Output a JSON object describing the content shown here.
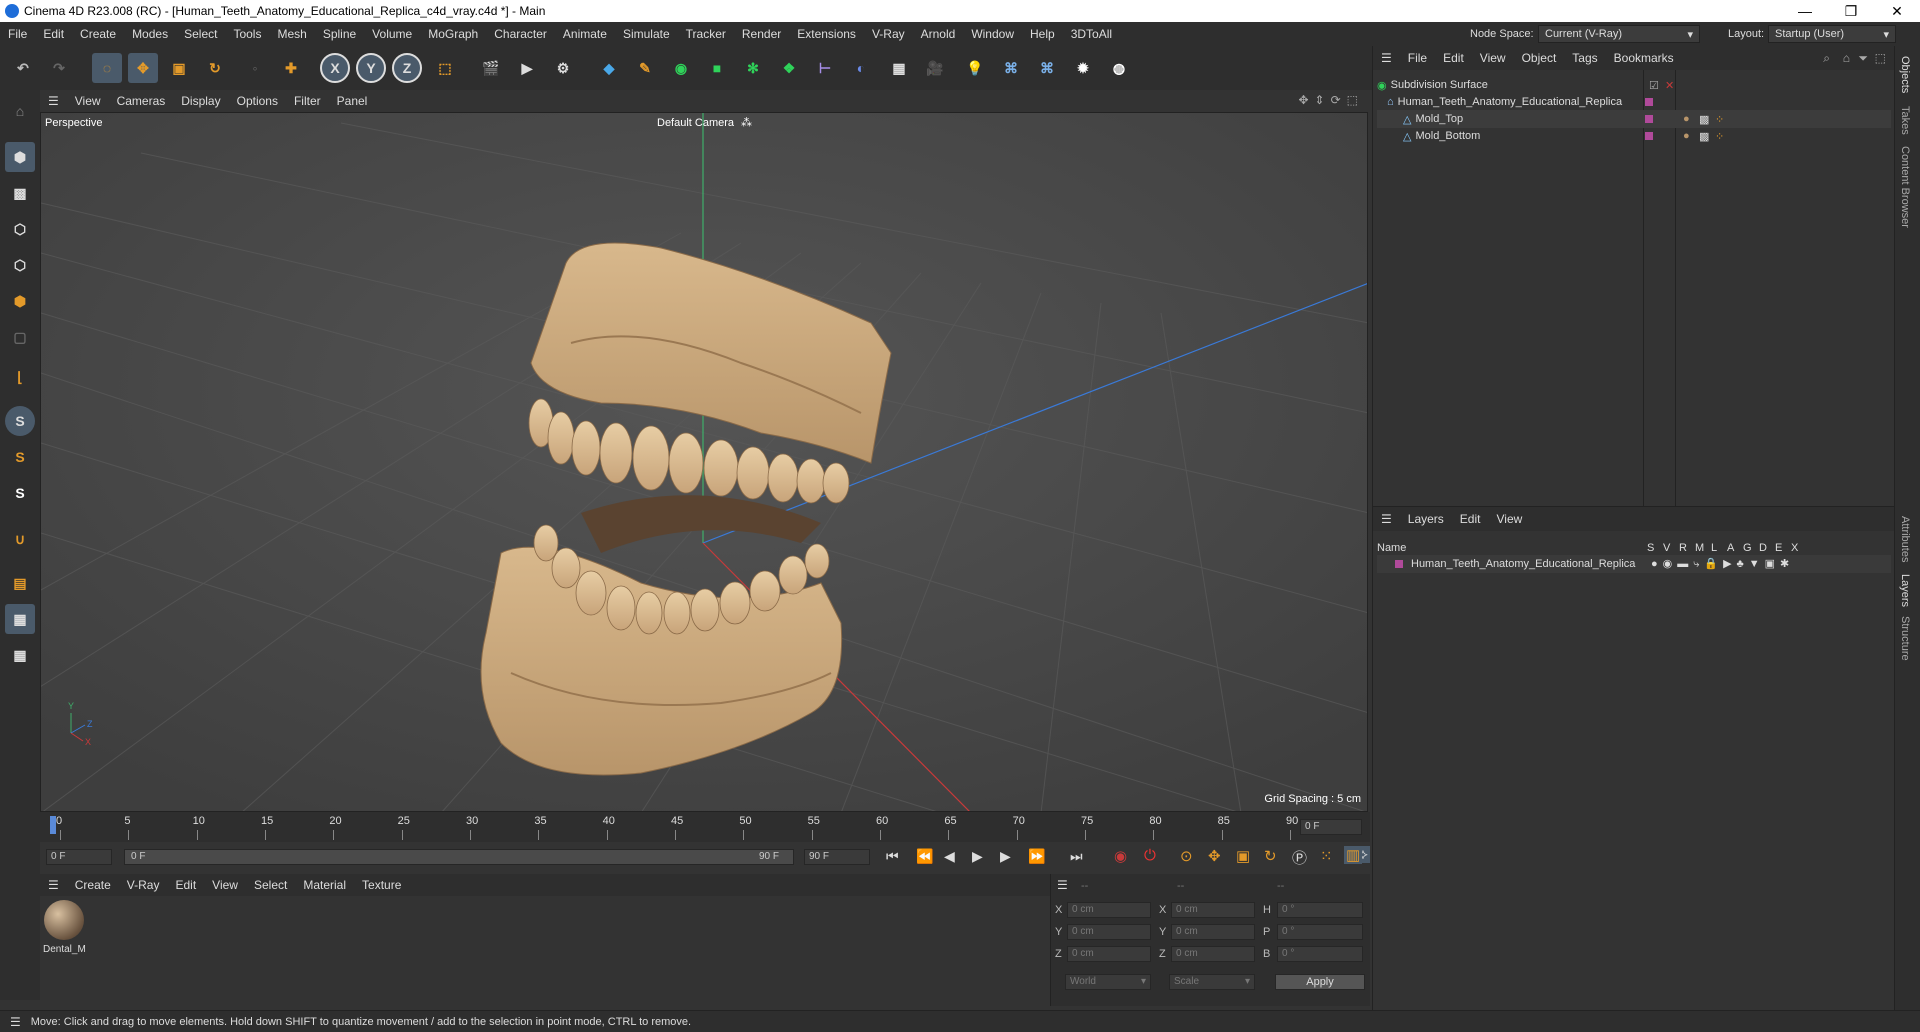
{
  "window": {
    "title": "Cinema 4D R23.008 (RC) - [Human_Teeth_Anatomy_Educational_Replica_c4d_vray.c4d *] - Main",
    "controls": [
      "—",
      "❐",
      "✕"
    ]
  },
  "menubar": {
    "items": [
      "File",
      "Edit",
      "Create",
      "Modes",
      "Select",
      "Tools",
      "Mesh",
      "Spline",
      "Volume",
      "MoGraph",
      "Character",
      "Animate",
      "Simulate",
      "Tracker",
      "Render",
      "Extensions",
      "V-Ray",
      "Arnold",
      "Window",
      "Help",
      "3DToAll"
    ],
    "node_space_label": "Node Space:",
    "node_space_value": "Current (V-Ray)",
    "layout_label": "Layout:",
    "layout_value": "Startup (User)"
  },
  "viewport": {
    "menu": [
      "View",
      "Cameras",
      "Display",
      "Options",
      "Filter",
      "Panel"
    ],
    "view_name": "Perspective",
    "camera": "Default Camera",
    "grid_spacing": "Grid Spacing : 5 cm",
    "axis_labels": [
      "Y",
      "Z",
      "X"
    ]
  },
  "timeline": {
    "ticks": [
      "0",
      "5",
      "10",
      "15",
      "20",
      "25",
      "30",
      "35",
      "40",
      "45",
      "50",
      "55",
      "60",
      "65",
      "70",
      "75",
      "80",
      "85",
      "90"
    ],
    "frame_right": "0 F",
    "start_field": "0 F",
    "current_field": "0 F",
    "end_label": "90 F",
    "end_field": "90 F",
    "playhead_frame": 0
  },
  "material_manager": {
    "menu": [
      "Create",
      "V-Ray",
      "Edit",
      "View",
      "Select",
      "Material",
      "Texture"
    ],
    "materials": [
      {
        "name": "Dental_M"
      }
    ]
  },
  "coordinates": {
    "header": [
      "--",
      "--",
      "--"
    ],
    "rows": [
      {
        "axis1": "X",
        "v1": "0 cm",
        "axis2": "X",
        "v2": "0 cm",
        "axis3": "H",
        "v3": "0 °"
      },
      {
        "axis1": "Y",
        "v1": "0 cm",
        "axis2": "Y",
        "v2": "0 cm",
        "axis3": "P",
        "v3": "0 °"
      },
      {
        "axis1": "Z",
        "v1": "0 cm",
        "axis2": "Z",
        "v2": "0 cm",
        "axis3": "B",
        "v3": "0 °"
      }
    ],
    "world": "World",
    "scale": "Scale",
    "apply": "Apply"
  },
  "object_manager": {
    "menu": [
      "File",
      "Edit",
      "View",
      "Object",
      "Tags",
      "Bookmarks"
    ],
    "objects": [
      {
        "name": "Subdivision Surface"
      },
      {
        "name": "Human_Teeth_Anatomy_Educational_Replica"
      },
      {
        "name": "Mold_Top"
      },
      {
        "name": "Mold_Bottom"
      }
    ]
  },
  "layer_manager": {
    "menu": [
      "Layers",
      "Edit",
      "View"
    ],
    "columns": [
      "Name",
      "S",
      "V",
      "R",
      "M",
      "L",
      "A",
      "G",
      "D",
      "E",
      "X"
    ],
    "layers": [
      {
        "name": "Human_Teeth_Anatomy_Educational_Replica"
      }
    ]
  },
  "right_tabs": [
    "Objects",
    "Takes",
    "Content Browser",
    "Attributes",
    "Layers",
    "Structure"
  ],
  "status": "Move: Click and drag to move elements. Hold down SHIFT to quantize movement / add to the selection in point mode, CTRL to remove.",
  "colors": {
    "accent": "#e39a2a",
    "layer": "#b04a9a",
    "teeth": "#c9a57a"
  }
}
